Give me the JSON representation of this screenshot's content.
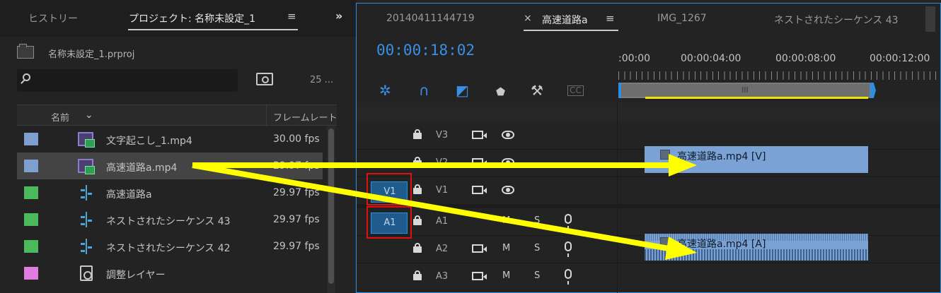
{
  "project_panel": {
    "tabs": [
      {
        "label": "ヒストリー"
      },
      {
        "label": "プロジェクト: 名称未設定_1"
      }
    ],
    "project_file": "名称未設定_1.prproj",
    "search": {
      "value": "",
      "placeholder": ""
    },
    "item_count": "25 ...",
    "columns": {
      "name": "名前",
      "frame_rate": "フレームレート"
    },
    "items": [
      {
        "name": "文字起こし_1.mp4",
        "rate": "30.00 fps",
        "label_color": "#7e9fd0",
        "icon": "clip-icon"
      },
      {
        "name": "高速道路a.mp4",
        "rate": "29.97 fps",
        "label_color": "#7e9fd0",
        "icon": "clip-icon"
      },
      {
        "name": "高速道路a",
        "rate": "29.97 fps",
        "label_color": "#4cba5c",
        "icon": "sequence-icon"
      },
      {
        "name": "ネストされたシーケンス 43",
        "rate": "29.97 fps",
        "label_color": "#4cba5c",
        "icon": "sequence-icon"
      },
      {
        "name": "ネストされたシーケンス 42",
        "rate": "29.97 fps",
        "label_color": "#4cba5c",
        "icon": "sequence-icon"
      },
      {
        "name": "調整レイヤー",
        "rate": "",
        "label_color": "#e07be0",
        "icon": "adjustment-layer-icon"
      }
    ]
  },
  "timeline_panel": {
    "tabs": [
      {
        "label": "20140411144719"
      },
      {
        "label": "高速道路a"
      },
      {
        "label": "IMG_1267"
      },
      {
        "label": "ネストされたシーケンス 43"
      }
    ],
    "close_glyph": "×",
    "timecode": "00:00:18:02",
    "ruler": [
      ":00:00",
      "00:00:04:00",
      "00:00:08:00",
      "00:00:12:00"
    ],
    "tracks": {
      "video": [
        {
          "name": "V3"
        },
        {
          "name": "V2"
        },
        {
          "name": "V1",
          "source_patch": "V1"
        }
      ],
      "audio": [
        {
          "name": "A1",
          "source_patch": "A1",
          "mute": "M",
          "solo": "S"
        },
        {
          "name": "A2",
          "mute": "M",
          "solo": "S"
        },
        {
          "name": "A3",
          "mute": "M",
          "solo": "S"
        }
      ]
    },
    "clips": {
      "video": "高速道路a.mp4 [V]",
      "audio": "高速道路a.mp4 [A]"
    }
  },
  "colors": {
    "accent_blue": "#2e8ee0",
    "annotation_yellow": "#ffff00",
    "highlight_red": "#e01010",
    "clip_blue": "#7aa2d4"
  }
}
